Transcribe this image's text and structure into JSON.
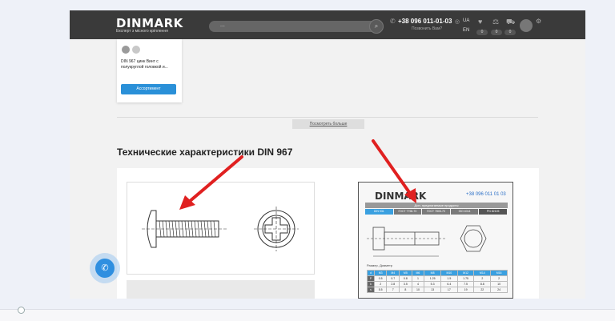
{
  "header": {
    "logo": "DINMARK",
    "tagline": "Експерт з місного кріплення",
    "search_placeholder": "...",
    "phone": "+38 096 011-01-03",
    "callback": "Позвонить Вам?",
    "lang_primary": "UA",
    "lang_secondary": "EN",
    "counts": [
      "0",
      "0",
      "0"
    ]
  },
  "product_card": {
    "name": "DIN 967 цинк Винт с полукруглой головкой и...",
    "button": "Ассортимент"
  },
  "more_link": "Посмотреть больше",
  "section_title": "Технические характеристики DIN 967",
  "sheet": {
    "logo": "DINMARK",
    "phone": "+38 096 011 01 03",
    "bar": "Доп. предлагаемые продукты",
    "tabs": [
      "DIN 931",
      "ГОСТ 7798-70",
      "ГОСТ 7805-70",
      "ISO 4014",
      "PN 82105"
    ],
    "dims_label": "Размер, Диаметр",
    "table_head": [
      "d",
      "M3",
      "M4",
      "M5",
      "M6",
      "M8",
      "M10",
      "M12",
      "M14",
      "M16"
    ],
    "table_rows": [
      {
        "label": "P",
        "cells": [
          "0.5",
          "0.7",
          "0.8",
          "1",
          "1.25",
          "1.5",
          "1.75",
          "2",
          "2"
        ]
      },
      {
        "label": "k",
        "cells": [
          "2",
          "2.8",
          "3.5",
          "4",
          "5.3",
          "6.4",
          "7.5",
          "8.8",
          "10"
        ]
      },
      {
        "label": "s",
        "cells": [
          "5.5",
          "7",
          "8",
          "10",
          "13",
          "17",
          "19",
          "22",
          "24"
        ]
      }
    ]
  }
}
